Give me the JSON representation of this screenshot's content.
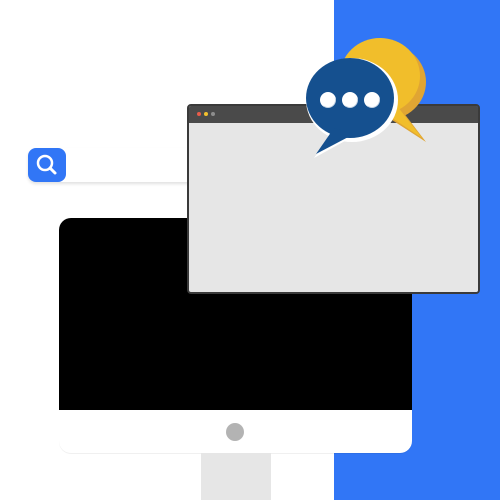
{
  "search": {
    "value": "",
    "placeholder": "",
    "icon": "search-icon"
  },
  "browser": {
    "window_controls": [
      "close-dot",
      "minimize-dot",
      "maximize-dot"
    ]
  },
  "chat": {
    "icons": [
      "speech-bubble-icon",
      "ellipsis-icon"
    ]
  },
  "colors": {
    "blue_panel": "#3176f6",
    "search_button": "#3176f6",
    "monitor_screen": "#000000",
    "monitor_chin": "#ffffff",
    "monitor_button": "#b3b3b3",
    "monitor_stand": "#e6e6e6",
    "browser_titlebar": "#4a4a4a",
    "browser_content": "#e6e6e6",
    "dot_close": "#e85c4a",
    "dot_minimize": "#f2c12e",
    "dot_maximize": "#8d8d8d",
    "bubble_front": "#15508f",
    "bubble_back": "#f1be2b",
    "bubble_back_shade": "#e0a533",
    "bubble_dots": "#ffffff"
  }
}
